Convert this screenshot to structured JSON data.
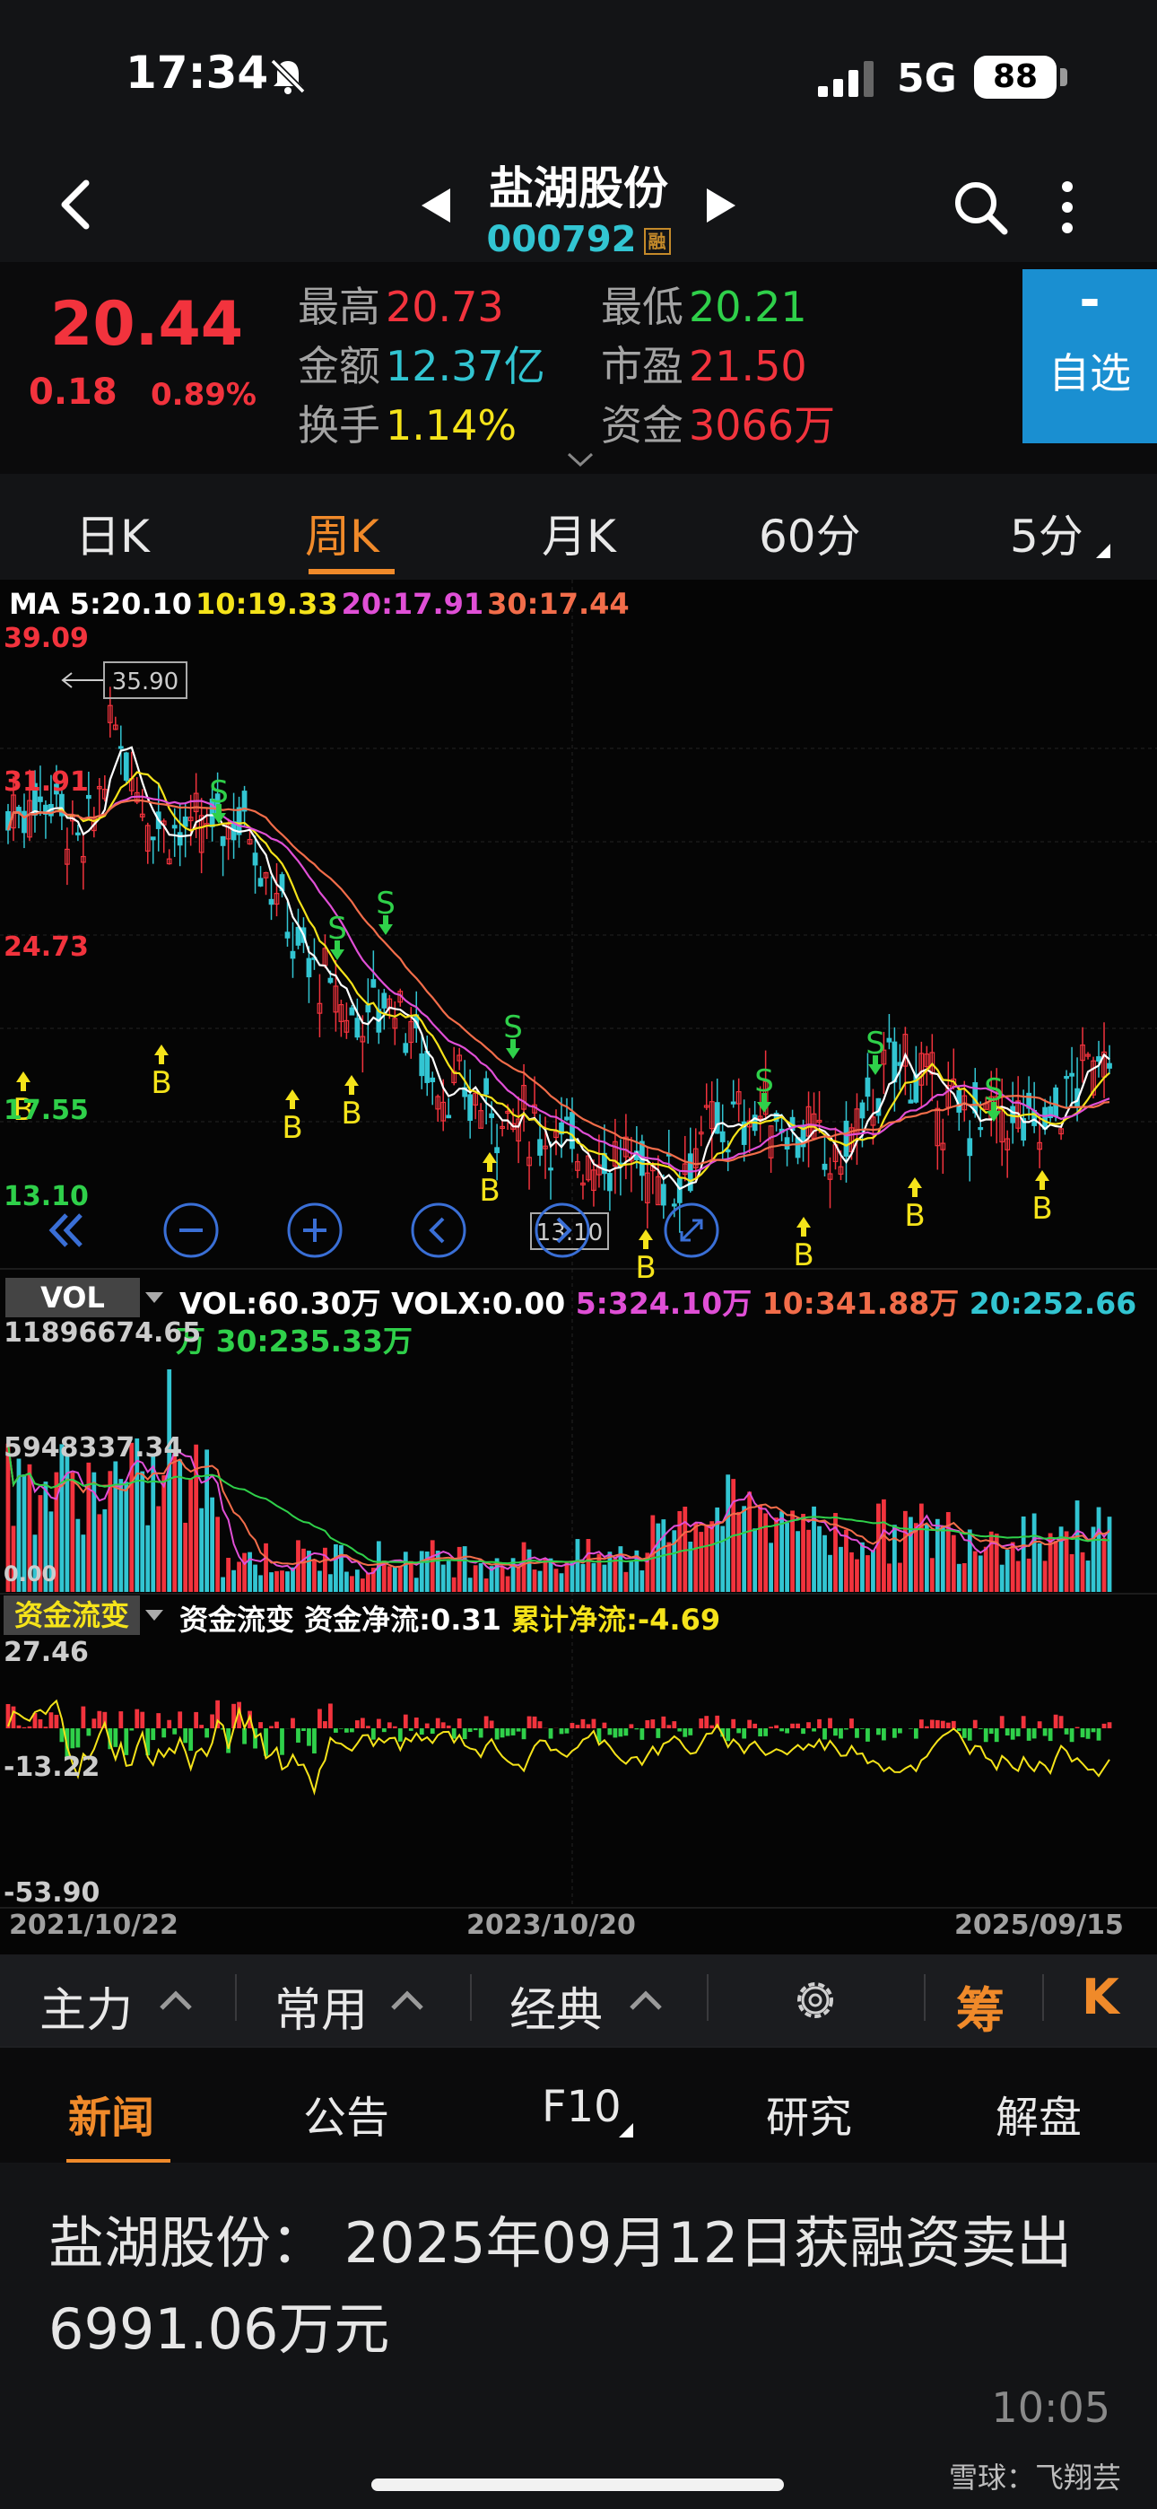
{
  "status_bar": {
    "time": "17:34",
    "network": "5G",
    "battery": "88"
  },
  "header": {
    "stock_name": "盐湖股份",
    "stock_code": "000792",
    "margin_badge": "融"
  },
  "quote": {
    "price": "20.44",
    "change": "0.18",
    "change_pct": "0.89%",
    "high_label": "最高",
    "high_value": "20.73",
    "low_label": "最低",
    "low_value": "20.21",
    "amount_label": "金额",
    "amount_value": "12.37亿",
    "pe_label": "市盈",
    "pe_value": "21.50",
    "turnover_label": "换手",
    "turnover_value": "1.14%",
    "capital_label": "资金",
    "capital_value": "3066万",
    "watch_symbol": "-",
    "watch_label": "自选"
  },
  "period_tabs": [
    {
      "label": "日K"
    },
    {
      "label": "周K"
    },
    {
      "label": "月K"
    },
    {
      "label": "60分"
    },
    {
      "label": "5分"
    }
  ],
  "active_period": "周K",
  "ma_legend": {
    "ma": "MA 5:20.10",
    "ma10": "10:19.33",
    "ma20": "20:17.91",
    "ma30": "30:17.44"
  },
  "price_axis": {
    "max": "39.09",
    "l2": "31.91",
    "l3": "24.73",
    "l4": "17.55",
    "min": "13.10",
    "peak_annotation": "35.90",
    "low_annotation": "13.10"
  },
  "vol_indicator": {
    "badge": "VOL",
    "line1_a": "VOL:60.30万 VOLX:0.00",
    "line1_b": "5:324.10万",
    "line1_c": "10:341.88万",
    "line1_d": "20:252.66",
    "line2": "万 30:235.33万",
    "axis_max": "11896674.65",
    "axis_mid": "5948337.34",
    "axis_min": "0.00"
  },
  "flow_indicator": {
    "badge": "资金流变",
    "name": "资金流变",
    "net": "资金净流:0.31",
    "cum": "累计净流:-4.69",
    "axis_max": "27.46",
    "axis_mid": "-13.22",
    "axis_min": "-53.90"
  },
  "dates": {
    "start": "2021/10/22",
    "mid": "2023/10/20",
    "end": "2025/09/15"
  },
  "signals": {
    "buy": "B",
    "sell": "S"
  },
  "indicator_bar": {
    "main": "主力",
    "common": "常用",
    "classic": "经典",
    "chou": "筹",
    "k": "K"
  },
  "news_tabs": [
    {
      "label": "新闻"
    },
    {
      "label": "公告"
    },
    {
      "label": "F10"
    },
    {
      "label": "研究"
    },
    {
      "label": "解盘"
    }
  ],
  "news": {
    "headline": "盐湖股份： 2025年09月12日获融资卖出6991.06万元",
    "time": "10:05",
    "watermark": "雪球：飞翔芸"
  },
  "colors": {
    "up": "#f2333d",
    "down": "#32c5d2",
    "ma5": "#ffffff",
    "ma10": "#f5e31a",
    "ma20": "#e04fd6",
    "ma30": "#f26d4a",
    "accent": "#f08a2a",
    "watch_bg": "#1a8fd1"
  },
  "icons": [
    "bell-slash-icon",
    "signal-icon",
    "back-icon",
    "prev-stock-icon",
    "next-stock-icon",
    "search-icon",
    "more-icon",
    "expand-icon",
    "double-left-icon",
    "zoom-out-icon",
    "zoom-in-icon",
    "scroll-left-icon",
    "scroll-right-icon",
    "fullscreen-icon",
    "gear-icon"
  ]
}
